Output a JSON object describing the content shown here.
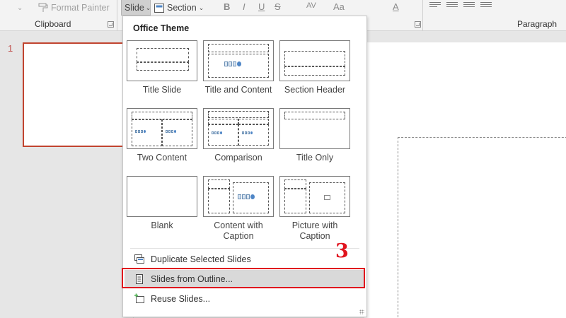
{
  "ribbon": {
    "format_painter": "Format Painter",
    "slide_button": "Slide",
    "section_button": "Section",
    "clipboard_label": "Clipboard",
    "paragraph_label": "Paragraph",
    "font_glyphs": {
      "bold": "B",
      "italic": "I",
      "underline": "U",
      "strike": "S",
      "char_spacing": "AV",
      "case": "Aa",
      "font_color": "A"
    }
  },
  "slides_panel": {
    "slide_number": "1"
  },
  "dropdown": {
    "theme_title": "Office Theme",
    "layouts": [
      {
        "line1": "Title Slide",
        "line2": ""
      },
      {
        "line1": "Title and Content",
        "line2": ""
      },
      {
        "line1": "Section Header",
        "line2": ""
      },
      {
        "line1": "Two Content",
        "line2": ""
      },
      {
        "line1": "Comparison",
        "line2": ""
      },
      {
        "line1": "Title Only",
        "line2": ""
      },
      {
        "line1": "Blank",
        "line2": ""
      },
      {
        "line1": "Content with",
        "line2": "Caption"
      },
      {
        "line1": "Picture with",
        "line2": "Caption"
      }
    ],
    "menu_items": [
      {
        "label": "Duplicate Selected Slides",
        "icon": "duplicate-slides-icon"
      },
      {
        "label": "Slides from Outline...",
        "icon": "outline-document-icon",
        "highlighted": true
      },
      {
        "label": "Reuse Slides...",
        "icon": "reuse-slides-icon"
      }
    ]
  },
  "annotation": {
    "step_number": "3",
    "color": "#e0141e"
  },
  "colors": {
    "selection_border": "#c1442f",
    "ribbon_bg": "#f3f3f3",
    "annotation_red": "#e0141e"
  }
}
